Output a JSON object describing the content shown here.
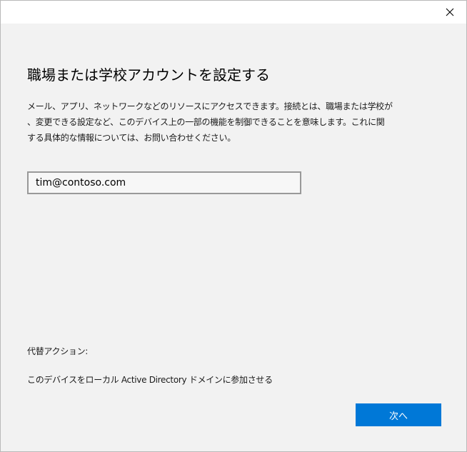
{
  "dialog": {
    "title": "職場または学校アカウントを設定する",
    "description_lines": [
      "メール、アプリ、ネットワークなどのリソースにアクセスできます。接続とは、職場または学校が",
      "、変更できる設定など、このデバイス上の一部の機能を制御できることを意味します。これに関",
      "する具体的な情報については、お問い合わせください。"
    ],
    "email_value": "tim@contoso.com",
    "alternate_actions_label": "代替アクション:",
    "join_ad_link": "このデバイスをローカル Active Directory ドメインに参加させる",
    "next_button": "次へ"
  },
  "titlebar": {
    "close_icon": "close-icon"
  },
  "colors": {
    "background": "#f2f2f2",
    "titlebar": "#ffffff",
    "accent": "#0078d7",
    "input_border": "#999999"
  }
}
